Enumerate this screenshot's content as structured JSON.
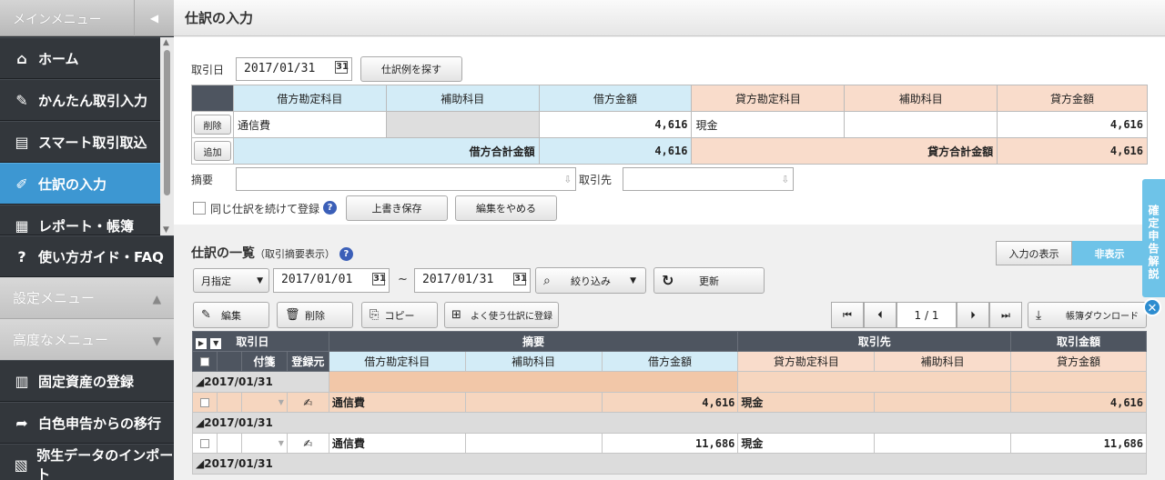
{
  "sidebar": {
    "header": "メインメニュー",
    "collapse_icon": "chevron-left-icon",
    "items": [
      {
        "label": "ホーム",
        "icon": "home-icon"
      },
      {
        "label": "かんたん取引入力",
        "icon": "pencil-icon"
      },
      {
        "label": "スマート取引取込",
        "icon": "import-icon"
      },
      {
        "label": "仕訳の入力",
        "icon": "journal-icon",
        "active": true
      },
      {
        "label": "レポート・帳簿",
        "icon": "report-icon"
      }
    ],
    "guide": "使い方ガイド・FAQ",
    "settings_menu": "設定メニュー",
    "advanced_menu": "高度なメニュー",
    "advanced_items": [
      {
        "label": "固定資産の登録",
        "icon": "building-icon"
      },
      {
        "label": "白色申告からの移行",
        "icon": "arrow-icon"
      },
      {
        "label": "弥生データのインポート",
        "icon": "file-import-icon"
      }
    ]
  },
  "header": {
    "title": "仕訳の入力"
  },
  "entry": {
    "date_label": "取引日",
    "date_value": "2017/01/31",
    "calendar_icon": "31",
    "example_button": "仕訳例を探す",
    "columns": [
      "借方勘定科目",
      "補助科目",
      "借方金額",
      "貸方勘定科目",
      "補助科目",
      "貸方金額"
    ],
    "delete_button": "削除",
    "add_button": "追加",
    "row": {
      "debit_account": "通信費",
      "debit_sub": "",
      "debit_amount": "4,616",
      "credit_account": "現金",
      "credit_sub": "",
      "credit_amount": "4,616"
    },
    "debit_total_label": "借方合計金額",
    "debit_total": "4,616",
    "credit_total_label": "貸方合計金額",
    "credit_total": "4,616",
    "memo_label": "摘要",
    "partner_label": "取引先",
    "continue_label": "同じ仕訳を続けて登録",
    "overwrite_button": "上書き保存",
    "cancel_button": "編集をやめる"
  },
  "list": {
    "title": "仕訳の一覧",
    "subtitle": "（取引摘要表示）",
    "toggle_show": "入力の表示",
    "toggle_hide": "非表示",
    "period_select": "月指定",
    "from_date": "2017/01/01",
    "to_date": "2017/01/31",
    "tilde": "~",
    "filter_button": "絞り込み",
    "refresh_button": "更新",
    "edit_button": "編集",
    "delete_button": "削除",
    "copy_button": "コピー",
    "register_button": "よく使う仕訳に登録",
    "page_current": "1",
    "page_sep": "/",
    "page_total": "1",
    "download_button": "帳簿ダウンロード",
    "head1": {
      "date": "取引日",
      "memo": "摘要",
      "partner": "取引先",
      "amount": "取引金額"
    },
    "head2": {
      "attach": "付箋",
      "source": "登録元",
      "debit_account": "借方勘定科目",
      "debit_sub": "補助科目",
      "debit_amount": "借方金額",
      "credit_account": "貸方勘定科目",
      "credit_sub": "補助科目",
      "credit_amount": "貸方金額"
    },
    "groups": [
      {
        "date": "2017/01/31",
        "row": {
          "debit_account": "通信費",
          "debit_amount": "4,616",
          "credit_account": "現金",
          "credit_amount": "4,616"
        }
      },
      {
        "date": "2017/01/31",
        "row": {
          "debit_account": "通信費",
          "debit_amount": "11,686",
          "credit_account": "現金",
          "credit_amount": "11,686"
        }
      },
      {
        "date": "2017/01/31"
      }
    ]
  },
  "side_tab": {
    "label": "確定申告解説"
  }
}
